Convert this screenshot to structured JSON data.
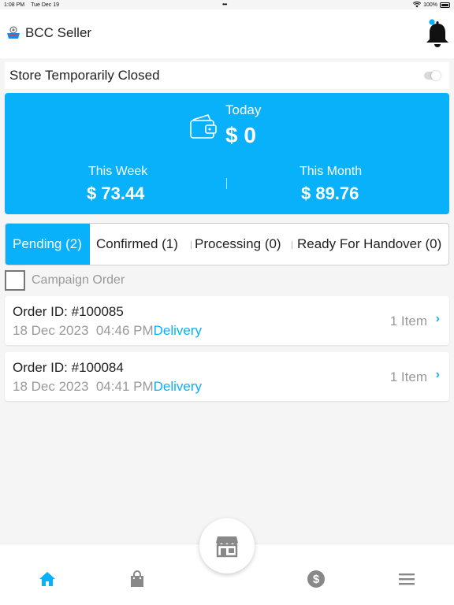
{
  "status_bar": {
    "time": "1:08 PM",
    "date": "Tue Dec 19",
    "battery": "100%"
  },
  "header": {
    "title": "BCC Seller",
    "logo": "bcc-logo-icon",
    "notification_icon": "bell-icon",
    "notification_dot_color": "#08b1fa"
  },
  "store": {
    "label": "Store Temporarily Closed",
    "toggle_on": false
  },
  "earnings": {
    "background": "#08b1fa",
    "today_label": "Today",
    "today_value": "$ 0",
    "week_label": "This Week",
    "week_value": "$ 73.44",
    "month_label": "This Month",
    "month_value": "$ 89.76"
  },
  "tabs": [
    {
      "label": "Pending (2)",
      "active": true
    },
    {
      "label": "Confirmed (1)",
      "active": false
    },
    {
      "label": "Processing (0)",
      "active": false
    },
    {
      "label": "Ready For Handover (0)",
      "active": false
    }
  ],
  "campaign": {
    "label": "Campaign Order",
    "checked": false
  },
  "orders": [
    {
      "id": "Order ID: #100085",
      "datetime": "18 Dec 2023  04:46 PM",
      "type": "Delivery",
      "count": "1 Item"
    },
    {
      "id": "Order ID: #100084",
      "datetime": "18 Dec 2023  04:41 PM",
      "type": "Delivery",
      "count": "1 Item"
    }
  ],
  "bottom_nav": {
    "items": [
      "home-icon",
      "shopping-bag-icon",
      "store-icon",
      "dollar-icon",
      "menu-icon"
    ],
    "active": "home-icon",
    "active_color": "#08b1fa",
    "inactive_color": "#888888"
  }
}
